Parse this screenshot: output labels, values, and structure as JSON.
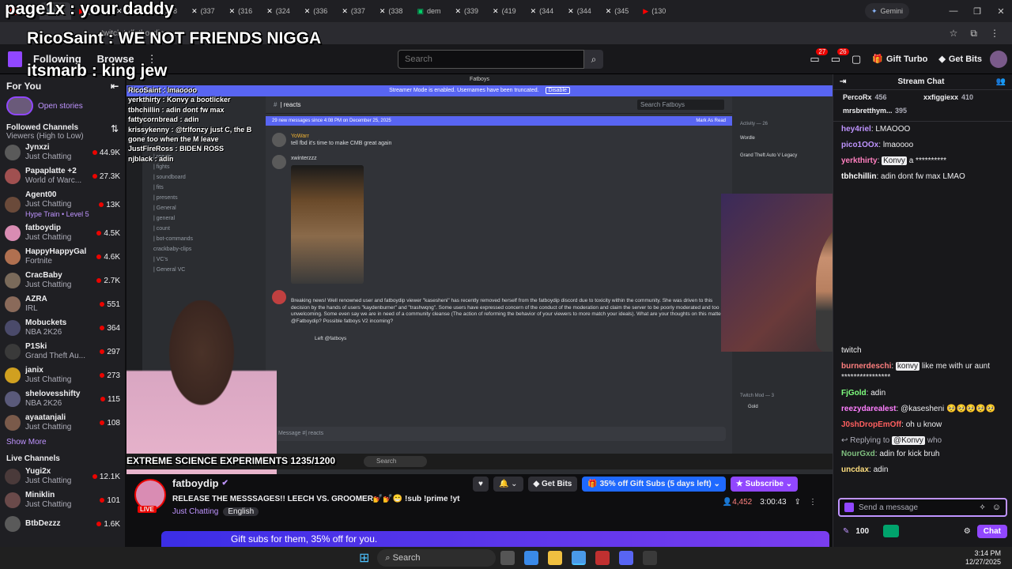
{
  "browser": {
    "tabs": [
      {
        "label": "(130",
        "color": "#ff0000"
      },
      {
        "label": "(295",
        "color": "#ffffff"
      },
      {
        "label": "(298",
        "color": "#ffffff"
      },
      {
        "label": "(337",
        "color": "#ffffff"
      },
      {
        "label": "(316",
        "color": "#ffffff"
      },
      {
        "label": "(324",
        "color": "#ffffff"
      },
      {
        "label": "(336",
        "color": "#ffffff"
      },
      {
        "label": "(337",
        "color": "#ffffff"
      },
      {
        "label": "(338",
        "color": "#ffffff"
      },
      {
        "label": "dem",
        "color": "#00d26a"
      },
      {
        "label": "(339",
        "color": "#ffffff"
      },
      {
        "label": "(419",
        "color": "#ffffff"
      },
      {
        "label": "(344",
        "color": "#ffffff"
      },
      {
        "label": "(344",
        "color": "#ffffff"
      },
      {
        "label": "(345",
        "color": "#ffffff"
      },
      {
        "label": "(130",
        "color": "#ff0000"
      }
    ],
    "gemini_label": "Gemini",
    "url": "twitch.tv/fatboydip"
  },
  "overlay": {
    "line1": "page1x : your daddy",
    "line2": "RicoSaint : WE NOT FRIENDS NIGGA",
    "line3": "itsmarb : king jew",
    "small": [
      "RicoSaint : lmaoooo",
      "yerkthirty : Konvy a bootlicker",
      "tbhchillin : adin dont fw max",
      "fattycornbread : adin",
      "krissykenny : @trlfonzy just C, the B",
      "gone too when the M leave",
      "JustFireRoss : BIDEN ROSS",
      "njblack : adin"
    ],
    "science": "EXTREME SCIENCE EXPERIMENTS 1235/1200"
  },
  "topnav": {
    "following": "Following",
    "browse": "Browse",
    "search_placeholder": "Search",
    "badge1": "27",
    "badge2": "26",
    "gift_turbo": "Gift Turbo",
    "get_bits": "Get Bits"
  },
  "sidebar": {
    "for_you": "For You",
    "open_stories": "Open stories",
    "followed_title": "Followed Channels",
    "followed_sort": "Viewers (High to Low)",
    "channels": [
      {
        "name": "Jynxzi",
        "cat": "Just Chatting",
        "viewers": "44.9K",
        "color": "#5a5a5a"
      },
      {
        "name": "Papaplatte +2",
        "cat": "World of Warc...",
        "viewers": "27.3K",
        "color": "#a05050"
      },
      {
        "name": "Agent00",
        "cat": "Just Chatting",
        "viewers": "13K",
        "color": "#6a4a3a"
      },
      {
        "name": "fatboydip",
        "cat": "Just Chatting",
        "viewers": "4.5K",
        "color": "#d98cb3"
      },
      {
        "name": "HappyHappyGal",
        "cat": "Fortnite",
        "viewers": "4.6K",
        "color": "#b07050"
      },
      {
        "name": "CracBaby",
        "cat": "Just Chatting",
        "viewers": "2.7K",
        "color": "#7a6a5a"
      },
      {
        "name": "AZRA",
        "cat": "IRL",
        "viewers": "551",
        "color": "#8a6a5a"
      },
      {
        "name": "Mobuckets",
        "cat": "NBA 2K26",
        "viewers": "364",
        "color": "#4a4a6a"
      },
      {
        "name": "P1Ski",
        "cat": "Grand Theft Au...",
        "viewers": "297",
        "color": "#3a3a3a"
      },
      {
        "name": "janix",
        "cat": "Just Chatting",
        "viewers": "273",
        "color": "#d0a020"
      },
      {
        "name": "shelovesshifty",
        "cat": "NBA 2K26",
        "viewers": "115",
        "color": "#5a5a7a"
      },
      {
        "name": "ayaatanjali",
        "cat": "Just Chatting",
        "viewers": "108",
        "color": "#7a5a4a"
      }
    ],
    "hype_train": "Hype Train • Level 5",
    "show_more": "Show More",
    "live_title": "Live Channels",
    "live": [
      {
        "name": "Yugi2x",
        "cat": "Just Chatting",
        "viewers": "12.1K",
        "color": "#4a3a3a"
      },
      {
        "name": "Miniklin",
        "cat": "Just Chatting",
        "viewers": "101",
        "color": "#6a4a4a"
      },
      {
        "name": "BtbDezzz",
        "cat": "",
        "viewers": "1.6K",
        "color": "#5a5a5a"
      }
    ]
  },
  "discord": {
    "banner": "Streamer Mode is enabled. Usernames have been truncated.",
    "banner_btn": "Disable",
    "server_title": "Fatboys",
    "channel": "| reacts",
    "new_messages": "29 new messages since 4:08 PM on December 25, 2025",
    "mark_read": "Mark As Read",
    "search_placeholder": "Search Fatboys",
    "channels": [
      "| reacts",
      "| fights",
      "| soundboard",
      "| fits",
      "| presents",
      "| General",
      "| general",
      "| count",
      "| bot-commands",
      "crackbaby-clips",
      "| VC's",
      "| General VC"
    ],
    "msg1_user": "YoWarr",
    "msg1_text": "tell fbd it's time to make CMB great again",
    "msg2_user": "xwinterzzz",
    "breaking": "Breaking news! Well renowned user and fatboydip viewer \"kasesheni\" has recently removed herself from the fatboydip discord due to toxicity within the community. She was driven to this decision by the hands of users \"kaydenburner\" and \"trashwqng\". Some users have expressed concern of the conduct of the moderation and claim the server to be poorly moderated and too unwelcoming. Some even say we are in need of a community cleanse (The action of reforming the behavior of your viewers to more match your ideals). What are your thoughts on this matter @Fatboydip? Possible fatboys V2 incoming?",
    "reply_text": "Left @fatboys",
    "msg_placeholder": "Message #| reacts",
    "activity": "Activity — 26",
    "twitch_mod": "Twitch Mod — 3",
    "act1": "Wordle",
    "act2": "Grand Theft Auto V Legacy",
    "gold": "Gold"
  },
  "stream": {
    "streamer": "fatboydip",
    "title": "RELEASE THE MESSSAGES!! LEECH VS. GROOMER💅💅😁 !sub !prime !yt",
    "category": "Just Chatting",
    "language": "English",
    "live": "LIVE",
    "viewers": "4,452",
    "uptime": "3:00:43",
    "get_bits": "Get Bits",
    "gift_subs": "35% off Gift Subs (5 days left)",
    "subscribe": "Subscribe",
    "banner": "Gift subs for them, 35% off for you."
  },
  "chat": {
    "title": "Stream Chat",
    "leaders": [
      {
        "name": "PercoRx",
        "amount": "456"
      },
      {
        "name": "xxfiggiexx",
        "amount": "410"
      },
      {
        "name": "mrsbretthym...",
        "amount": "395"
      }
    ],
    "messages_top": [
      {
        "user": "hey4riel",
        "color": "#bf94ff",
        "text": "LMAOOO"
      },
      {
        "user": "pico1OOx",
        "color": "#bf94ff",
        "text": "lmaoooo"
      },
      {
        "user": "yerkthirty",
        "color": "#ff7fbf",
        "mention": "Konvy",
        "text": "a **********"
      },
      {
        "user": "tbhchillin",
        "color": "#ffffff",
        "text": "adin dont fw max LMAO"
      }
    ],
    "twitch_word": "twitch",
    "messages_bottom": [
      {
        "user": "burnerdeschi",
        "color": "#ff7f7f",
        "mention": "konvy",
        "text": "like me with ur aunt ****************"
      },
      {
        "user": "FjGold",
        "color": "#7fff7f",
        "text": "adin"
      },
      {
        "user": "reezydarealest",
        "color": "#ff7fff",
        "text": "@kasesheni 🥺🥺🥺🥺🥺"
      },
      {
        "user": "J0shDropEmOff",
        "color": "#ff5f5f",
        "text": "oh u know"
      }
    ],
    "reply_label": "Replying to",
    "reply_mention": "@Konvy",
    "reply_text": "who",
    "nourgxd": {
      "user": "NourGxd",
      "text": "adin for kick bruh"
    },
    "uncdax": {
      "user": "uncdax",
      "text": "adin"
    },
    "input_placeholder": "Send a message",
    "points": "100",
    "chat_btn": "Chat"
  },
  "taskbar": {
    "search": "Search",
    "time": "3:14 PM",
    "date": "12/27/2025"
  }
}
